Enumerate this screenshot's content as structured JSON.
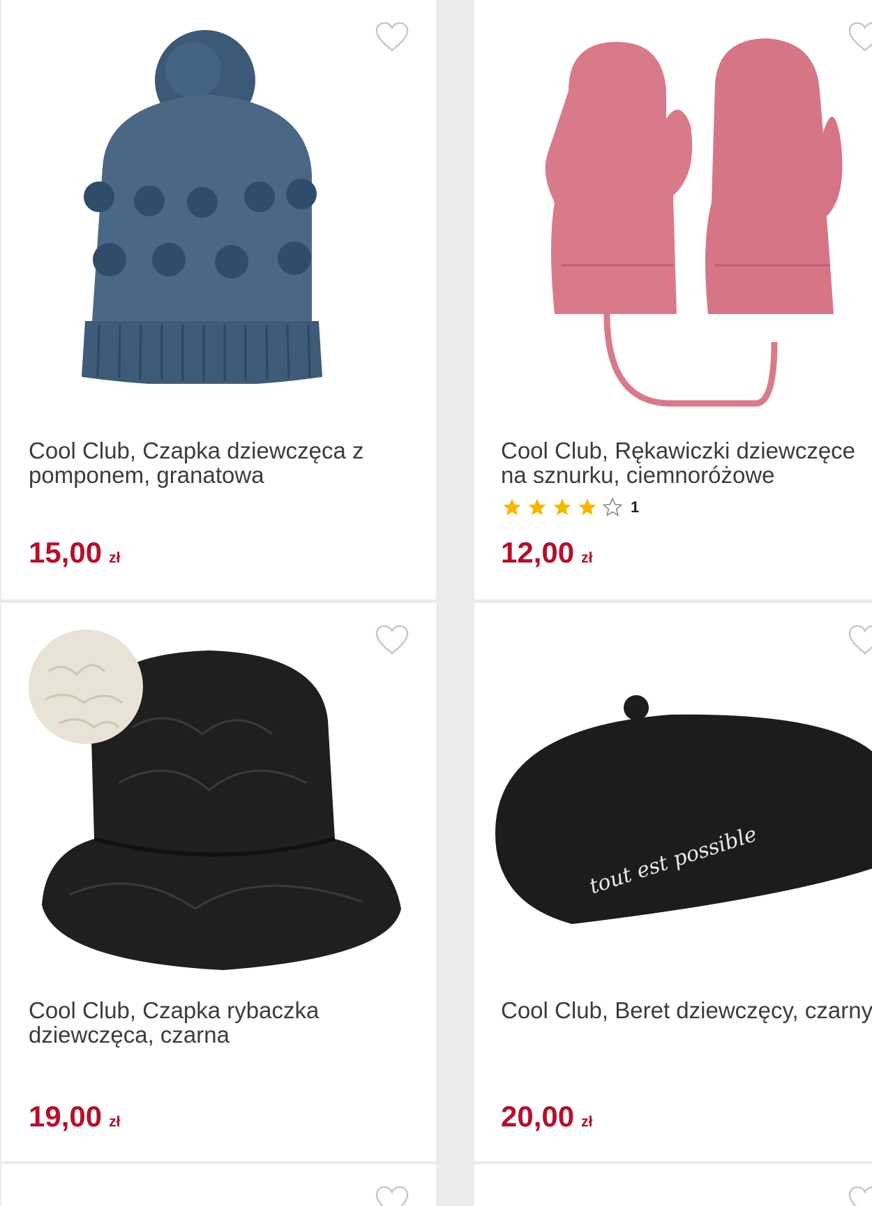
{
  "products": [
    {
      "title": "Cool Club, Czapka dziewczęca z pomponem, granatowa",
      "price": "15,00",
      "currency": "zł",
      "image": "navy-pompom-beanie",
      "color": "#3f5a75"
    },
    {
      "title_line1": "Cool Club, Rękawiczki dziewczęce",
      "title_line2": "na sznurku, ciemnoróżowe",
      "rating": {
        "value": 4,
        "max": 5,
        "count": "1"
      },
      "price": "12,00",
      "currency": "zł",
      "image": "pink-mittens-on-string",
      "color": "#d97a8a"
    },
    {
      "title": "Cool Club, Czapka rybaczka dziewczęca, czarna",
      "price": "19,00",
      "currency": "zł",
      "image": "black-quilted-bucket-hat",
      "color": "#1e1e1e"
    },
    {
      "title_line1": "Cool Club, Beret dziewczęcy, czarny",
      "price": "20,00",
      "currency": "zł",
      "image": "black-beret",
      "beret_text": "tout est possible",
      "color": "#1c1c1c"
    }
  ],
  "colors": {
    "price": "#b5102c",
    "star": "#f5b800",
    "background": "#ebebeb"
  }
}
